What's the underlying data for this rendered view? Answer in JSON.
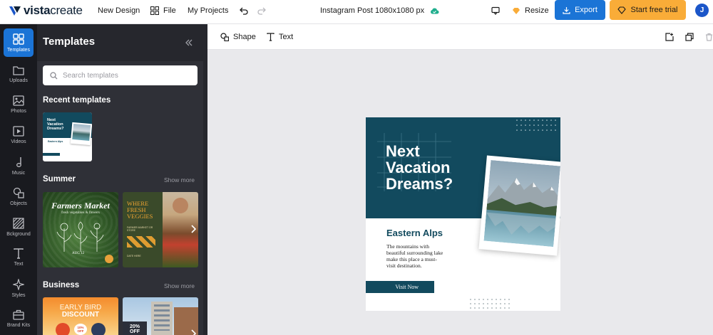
{
  "brand": {
    "name_bold": "vista",
    "name_light": "create"
  },
  "header": {
    "new_design": "New Design",
    "file": "File",
    "my_projects": "My Projects",
    "doc_title": "Instagram Post 1080x1080 px",
    "resize": "Resize",
    "export": "Export",
    "trial": "Start free trial",
    "avatar_initial": "J"
  },
  "rail": {
    "items": [
      {
        "label": "Templates",
        "icon": "templates-icon"
      },
      {
        "label": "Uploads",
        "icon": "folder-icon"
      },
      {
        "label": "Photos",
        "icon": "image-icon"
      },
      {
        "label": "Videos",
        "icon": "play-icon"
      },
      {
        "label": "Music",
        "icon": "music-note-icon"
      },
      {
        "label": "Objects",
        "icon": "shapes-icon"
      },
      {
        "label": "Bckground",
        "icon": "background-icon"
      },
      {
        "label": "Text",
        "icon": "text-icon"
      },
      {
        "label": "Styles",
        "icon": "sparkle-icon"
      },
      {
        "label": "Brand Kits",
        "icon": "briefcase-icon"
      }
    ]
  },
  "panel": {
    "title": "Templates",
    "search_placeholder": "Search templates",
    "recent_title": "Recent templates",
    "sections": [
      {
        "title": "Summer",
        "more": "Show more"
      },
      {
        "title": "Business",
        "more": "Show more"
      }
    ],
    "recent_thumb": {
      "headline": "Next Vacation Dreams?",
      "sub": "Eastern Alps"
    },
    "summer_thumbs": [
      {
        "title": "Farmers Market",
        "sub": "fresh vegetables & flowers",
        "date": "AUG 12"
      },
      {
        "title": "WHERE FRESH VEGGIES",
        "sub": "FARMER MARKET OR STORE",
        "footer": "DATE HERE"
      }
    ],
    "business_thumbs": [
      {
        "title": "EARLY BIRD",
        "title2": "DISCOUNT",
        "badge": "10% OFF"
      },
      {
        "badge": "20% OFF"
      }
    ]
  },
  "toolbar": {
    "shape": "Shape",
    "text": "Text"
  },
  "canvas": {
    "headline": [
      "Next",
      "Vacation",
      "Dreams?"
    ],
    "subtitle": "Eastern Alps",
    "body": [
      "The mountains with",
      "beautiful surrounding lake",
      "make this place a must-",
      "visit destination."
    ],
    "cta": "Visit Now"
  },
  "colors": {
    "teal": "#124a5e",
    "accent_blue": "#1b74d6",
    "accent_orange": "#f9ac38",
    "rail_bg": "#191a1f",
    "panel_bg": "#26272d"
  }
}
